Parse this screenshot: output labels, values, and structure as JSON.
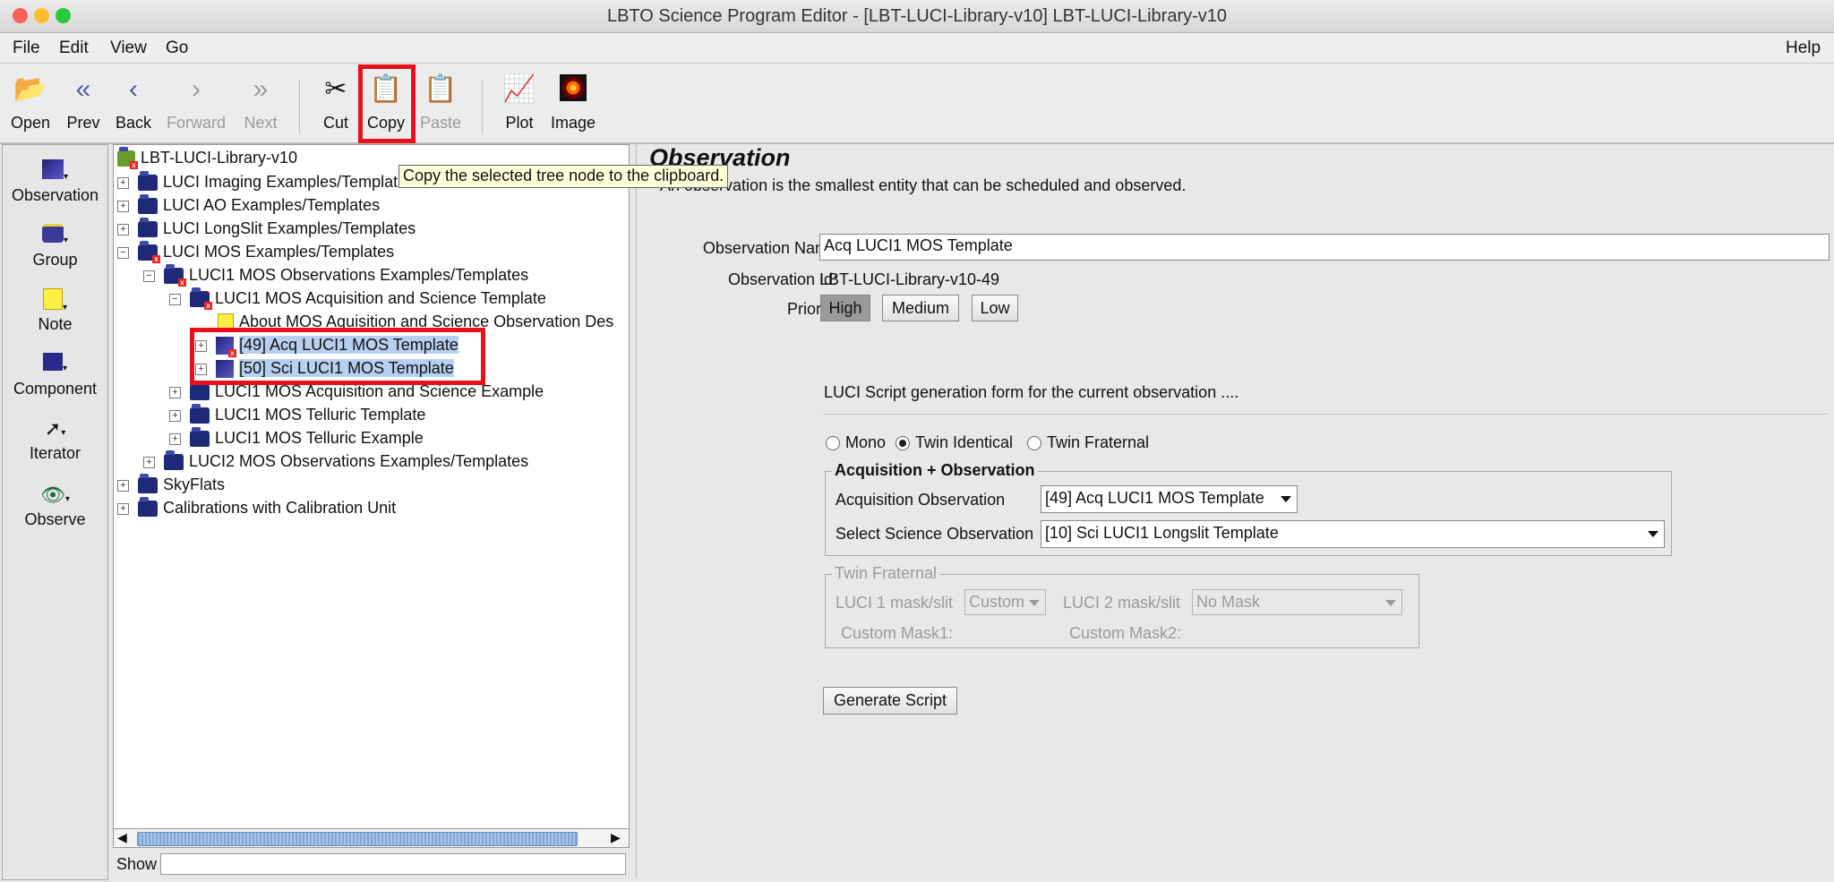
{
  "window": {
    "title": "LBTO Science Program Editor - [LBT-LUCI-Library-v10] LBT-LUCI-Library-v10"
  },
  "menubar": {
    "items": [
      "File",
      "Edit",
      "View",
      "Go"
    ],
    "help": "Help"
  },
  "toolbar": {
    "open": "Open",
    "prev": "Prev",
    "back": "Back",
    "forward": "Forward",
    "next": "Next",
    "cut": "Cut",
    "copy": "Copy",
    "paste": "Paste",
    "plot": "Plot",
    "image": "Image"
  },
  "tooltip": "Copy the selected tree node to the clipboard.",
  "palette": {
    "items": [
      "Observation",
      "Group",
      "Note",
      "Component",
      "Iterator",
      "Observe"
    ]
  },
  "tree": {
    "root": "LBT-LUCI-Library-v10",
    "rows": [
      "LUCI Imaging Examples/Templates",
      "LUCI AO Examples/Templates",
      "LUCI LongSlit Examples/Templates",
      "LUCI MOS Examples/Templates",
      "LUCI1 MOS Observations Examples/Templates",
      "LUCI1 MOS Acquisition and Science Template",
      "About MOS Aquisition and Science Observation Des",
      "[49] Acq LUCI1 MOS Template",
      "[50] Sci LUCI1 MOS Template",
      "LUCI1 MOS Acquisition and Science Example",
      "LUCI1 MOS Telluric Template",
      "LUCI1 MOS Telluric Example",
      "LUCI2 MOS Observations Examples/Templates",
      "SkyFlats",
      "Calibrations with Calibration Unit"
    ]
  },
  "show": {
    "label": "Show",
    "value": ""
  },
  "editor": {
    "heading": "Observation",
    "description": "An observation is the smallest entity that can be scheduled and observed.",
    "name_label": "Observation Name",
    "name_value": "Acq LUCI1 MOS Template",
    "id_label": "Observation Id:",
    "id_value": "LBT-LUCI-Library-v10-49",
    "priority_label": "Priority",
    "priority": [
      "High",
      "Medium",
      "Low"
    ],
    "priority_selected": "High",
    "script_form_label": "LUCI Script generation form for the current observation ....",
    "modes": [
      "Mono",
      "Twin Identical",
      "Twin Fraternal"
    ],
    "mode_selected": "Twin Identical",
    "acq_group": {
      "title": "Acquisition + Observation",
      "acq_label": "Acquisition Observation",
      "acq_value": "[49] Acq LUCI1 MOS Template",
      "sci_label": "Select Science Observation",
      "sci_value": "[10] Sci LUCI1 Longslit Template"
    },
    "twin_group": {
      "title": "Twin Fraternal",
      "mask1_label": "LUCI 1 mask/slit",
      "mask1_value": "Custom",
      "mask2_label": "LUCI 2 mask/slit",
      "mask2_value": "No Mask",
      "custom1_label": "Custom Mask1:",
      "custom2_label": "Custom Mask2:"
    },
    "generate": "Generate Script"
  }
}
